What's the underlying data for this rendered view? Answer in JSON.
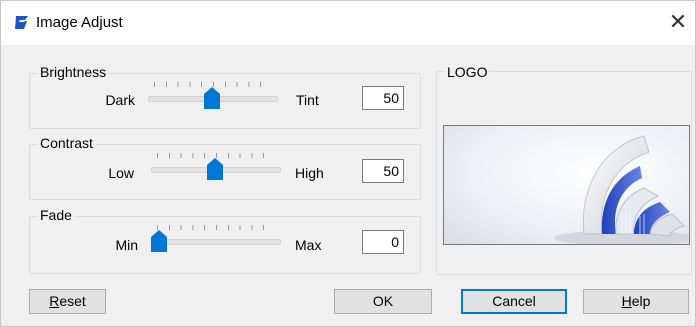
{
  "window": {
    "title": "Image Adjust",
    "close_glyph": "✕"
  },
  "brightness": {
    "group_label": "Brightness",
    "min_label": "Dark",
    "max_label": "Tint",
    "value": "50",
    "level": 50
  },
  "contrast": {
    "group_label": "Contrast",
    "min_label": "Low",
    "max_label": "High",
    "value": "50",
    "level": 50
  },
  "fade": {
    "group_label": "Fade",
    "min_label": "Min",
    "max_label": "Max",
    "value": "0",
    "level": 0
  },
  "preview": {
    "group_label": "LOGO"
  },
  "buttons": {
    "reset": {
      "mnemonic": "R",
      "rest": "eset"
    },
    "ok": "OK",
    "cancel": "Cancel",
    "help": {
      "mnemonic": "H",
      "rest": "elp"
    }
  },
  "colors": {
    "accent": "#0078d7",
    "icon": "#1a56c7"
  },
  "icons": {
    "app": "gstarcad-g-icon",
    "close": "close-icon"
  }
}
